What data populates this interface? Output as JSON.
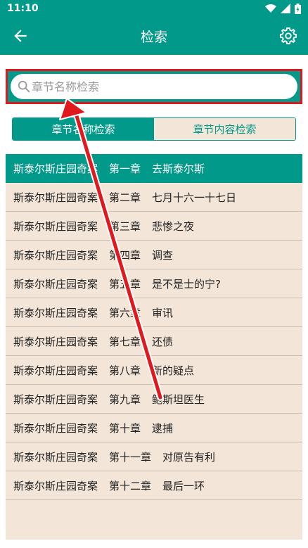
{
  "status": {
    "time": "11:10"
  },
  "header": {
    "title": "检索"
  },
  "search": {
    "placeholder": "章节名称检索"
  },
  "tabs": [
    {
      "label": "章节名称检索",
      "active": true
    },
    {
      "label": "章节内容检索",
      "active": false
    }
  ],
  "chapters": [
    {
      "book": "斯泰尔斯庄园奇案",
      "chapter": "第一章",
      "title": "去斯泰尔斯"
    },
    {
      "book": "斯泰尔斯庄园奇案",
      "chapter": "第二章",
      "title": "七月十六一十七日"
    },
    {
      "book": "斯泰尔斯庄园奇案",
      "chapter": "第三章",
      "title": "悲惨之夜"
    },
    {
      "book": "斯泰尔斯庄园奇案",
      "chapter": "第四章",
      "title": "调查"
    },
    {
      "book": "斯泰尔斯庄园奇案",
      "chapter": "第五章",
      "title": "是不是士的宁?"
    },
    {
      "book": "斯泰尔斯庄园奇案",
      "chapter": "第六章",
      "title": "审讯"
    },
    {
      "book": "斯泰尔斯庄园奇案",
      "chapter": "第七章",
      "title": "还债"
    },
    {
      "book": "斯泰尔斯庄园奇案",
      "chapter": "第八章",
      "title": "新的疑点"
    },
    {
      "book": "斯泰尔斯庄园奇案",
      "chapter": "第九章",
      "title": "鲍斯坦医生"
    },
    {
      "book": "斯泰尔斯庄园奇案",
      "chapter": "第十章",
      "title": "逮捕"
    },
    {
      "book": "斯泰尔斯庄园奇案",
      "chapter": "第十一章",
      "title": "对原告有利"
    },
    {
      "book": "斯泰尔斯庄园奇案",
      "chapter": "第十二章",
      "title": "最后一环"
    }
  ],
  "colors": {
    "primary": "#00998a",
    "list_bg": "#f3e6d8",
    "highlight": "#e0191f"
  },
  "icons": [
    "back-arrow-icon",
    "gear-icon",
    "search-icon",
    "wifi-icon",
    "signal-icon",
    "battery-icon"
  ]
}
